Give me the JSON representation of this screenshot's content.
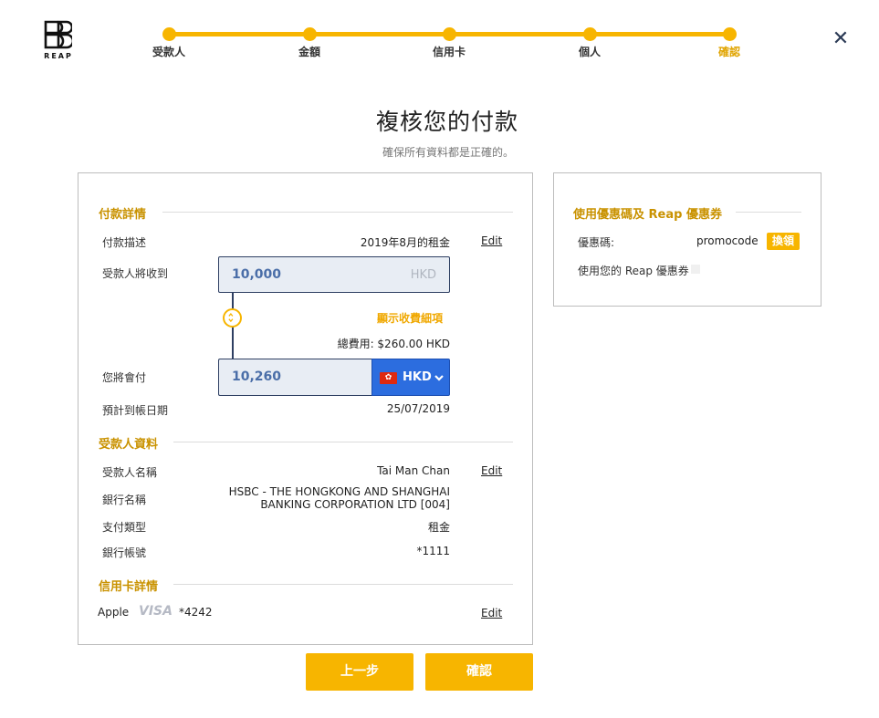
{
  "logo": {
    "text": "REAP"
  },
  "steps": [
    {
      "label": "受款人",
      "active": false
    },
    {
      "label": "金額",
      "active": false
    },
    {
      "label": "信用卡",
      "active": false
    },
    {
      "label": "個人",
      "active": false
    },
    {
      "label": "確認",
      "active": true
    }
  ],
  "close_symbol": "✕",
  "title": "複核您的付款",
  "subtitle": "確保所有資料都是正確的。",
  "payment": {
    "section_title": "付款詳情",
    "description_label": "付款描述",
    "description_value": "2019年8月的租金",
    "edit_label": "Edit",
    "receive_label": "受款人將收到",
    "receive_amount": "10,000",
    "receive_currency": "HKD",
    "fee_link": "顯示收費細項",
    "fee_total": "總費用: $260.00 HKD",
    "pay_label": "您將會付",
    "pay_amount": "10,260",
    "pay_currency": "HKD",
    "arrival_label": "預計到帳日期",
    "arrival_value": "25/07/2019"
  },
  "recipient": {
    "section_title": "受款人資料",
    "name_label": "受款人名稱",
    "name_value": "Tai Man Chan",
    "edit_label": "Edit",
    "bank_label": "銀行名稱",
    "bank_value_line1": "HSBC - THE HONGKONG AND SHANGHAI",
    "bank_value_line2": "BANKING CORPORATION LTD [004]",
    "type_label": "支付類型",
    "type_value": "租金",
    "account_label": "銀行帳號",
    "account_value": "*1111"
  },
  "credit_card": {
    "section_title": "信用卡詳情",
    "wallet": "Apple",
    "brand": "VISA",
    "last4": "*4242",
    "edit_label": "Edit"
  },
  "promo": {
    "title": "使用優惠碼及 Reap 優惠券",
    "code_label": "優惠碼:",
    "code_value": "promocode",
    "redeem_label": "換領",
    "voucher_label": "使用您的 Reap 優惠券"
  },
  "buttons": {
    "back": "上一步",
    "confirm": "確認"
  },
  "colors": {
    "accent": "#f7b500",
    "section_heading": "#c99200",
    "currency_button": "#2c6ddf",
    "input_border": "#2e3f62"
  },
  "icons": [
    "reap-logo-icon",
    "close-icon",
    "swap-arrows-icon",
    "hk-flag-icon",
    "chevron-down-icon",
    "visa-logo"
  ]
}
